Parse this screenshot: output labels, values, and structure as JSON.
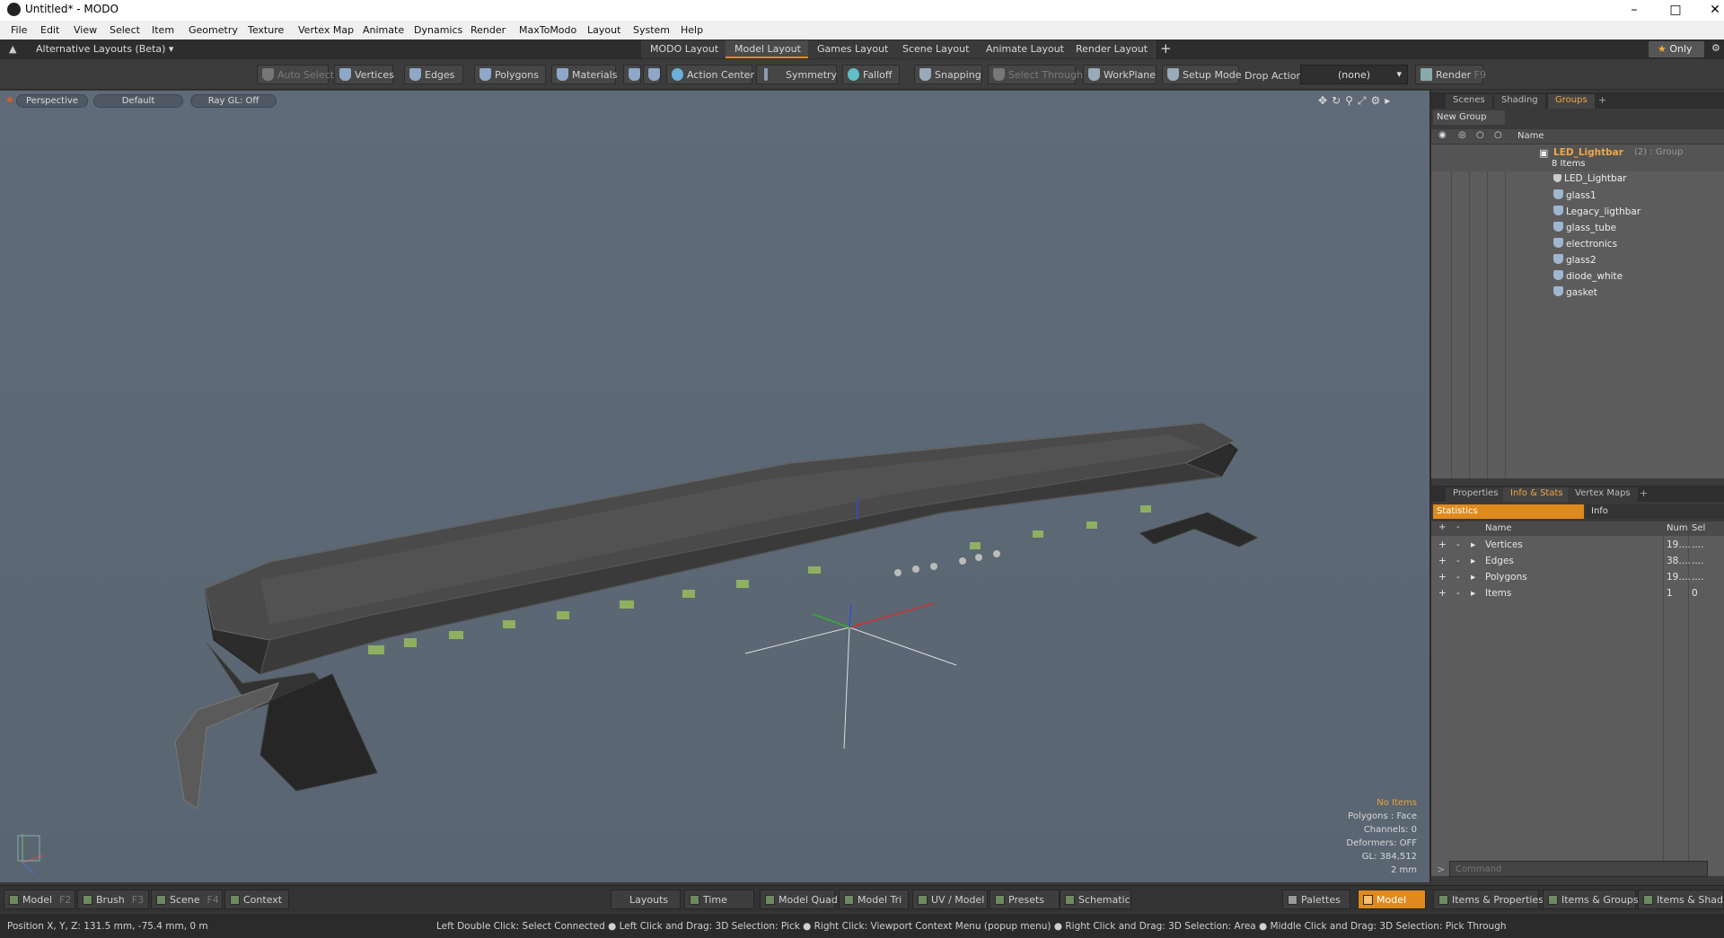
{
  "window": {
    "title": "Untitled* - MODO"
  },
  "menu": [
    "File",
    "Edit",
    "View",
    "Select",
    "Item",
    "Geometry",
    "Texture",
    "Vertex Map",
    "Animate",
    "Dynamics",
    "Render",
    "MaxToModo",
    "Layout",
    "System",
    "Help"
  ],
  "layoutbar": {
    "alt_layouts": "Alternative Layouts (Beta)",
    "tabs": [
      "MODO Layout",
      "Model Layout",
      "Games Layout",
      "Scene Layout",
      "Animate Layout",
      "Render Layout"
    ],
    "active_tab": "Model Layout",
    "plus": "+",
    "only": "Only"
  },
  "toolbar": {
    "auto_select": "Auto Select",
    "vertices": "Vertices",
    "edges": "Edges",
    "polygons": "Polygons",
    "materials": "Materials",
    "action_center": "Action Center",
    "symmetry": "Symmetry",
    "falloff": "Falloff",
    "snapping": "Snapping",
    "select_through": "Select Through",
    "workplane": "WorkPlane",
    "setup_mode": "Setup Mode",
    "drop_action": "Drop Action",
    "drop_value": "(none)",
    "render": "Render",
    "render_key": "F9"
  },
  "viewport": {
    "view": "Perspective",
    "style": "Default",
    "raygl": "Ray GL: Off",
    "info": {
      "items": "No Items",
      "polygons": "Polygons : Face",
      "channels": "Channels: 0",
      "deformers": "Deformers: OFF",
      "gl": "GL: 384,512",
      "scale": "2 mm"
    }
  },
  "groups_panel": {
    "tabs": [
      "Scenes",
      "Shading",
      "Groups"
    ],
    "active_tab": "Groups",
    "new_group": "New Group",
    "name_header": "Name",
    "group": {
      "name": "LED_Lightbar",
      "suffix": "(2) : Group",
      "count": "8 Items"
    },
    "items": [
      "LED_Lightbar",
      "glass1",
      "Legacy_ligthbar",
      "glass_tube",
      "electronics",
      "glass2",
      "diode_white",
      "gasket"
    ]
  },
  "stats_panel": {
    "tabs": [
      "Properties",
      "Info & Stats",
      "Vertex Maps"
    ],
    "active_tab": "Info & Stats",
    "subtabs": [
      "Statistics",
      "Info"
    ],
    "headers": {
      "name": "Name",
      "num": "Num",
      "sel": "Sel"
    },
    "rows": [
      {
        "name": "Vertices",
        "num": "19....",
        "sel": "...."
      },
      {
        "name": "Edges",
        "num": "38....",
        "sel": "...."
      },
      {
        "name": "Polygons",
        "num": "19....",
        "sel": "...."
      },
      {
        "name": "Items",
        "num": "1",
        "sel": "0"
      }
    ],
    "command_placeholder": "Command"
  },
  "bottombar": {
    "model": "Model",
    "model_key": "F2",
    "brush": "Brush",
    "brush_key": "F3",
    "scene": "Scene",
    "scene_key": "F4",
    "context": "Context",
    "layouts": "Layouts",
    "time": "Time",
    "model_quad": "Model Quad",
    "model_tri": "Model Tri",
    "uv_model": "UV / Model",
    "presets": "Presets",
    "schematic": "Schematic",
    "palettes": "Palettes",
    "model_active": "Model",
    "items_props": "Items & Properties",
    "items_groups": "Items & Groups",
    "items_shading": "Items & Shading"
  },
  "statusbar": {
    "position": "Position X, Y, Z:   131.5 mm, -75.4 mm, 0 m",
    "hint": "Left Double Click: Select Connected ● Left Click and Drag: 3D Selection: Pick ● Right Click: Viewport Context Menu (popup menu) ● Right Click and Drag: 3D Selection: Area ● Middle Click and Drag: 3D Selection: Pick Through"
  },
  "colors": {
    "accent": "#e08a1e",
    "viewport_bg": "#5d6976",
    "panel_bg": "#3a3a3a"
  }
}
